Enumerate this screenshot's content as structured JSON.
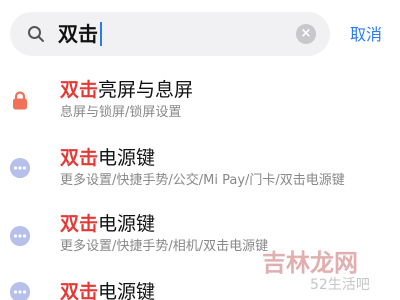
{
  "search": {
    "query": "双击",
    "cancel_label": "取消",
    "clear_glyph": "×"
  },
  "results": [
    {
      "title_highlight": "双击",
      "title_rest": "亮屏与息屏",
      "path": "息屏与锁屏/锁屏设置",
      "icon": "lock-icon"
    },
    {
      "title_highlight": "双击",
      "title_rest": "电源键",
      "path": "更多设置/快捷手势/公交/Mi Pay/门卡/双击电源键",
      "icon": "more-dots-icon"
    },
    {
      "title_highlight": "双击",
      "title_rest": "电源键",
      "path": "更多设置/快捷手势/相机/双击电源键",
      "icon": "more-dots-icon"
    },
    {
      "title_highlight": "双击",
      "title_rest": "电源键",
      "path": "",
      "icon": "more-dots-icon"
    }
  ],
  "watermark": {
    "main": "吉林龙网",
    "sub": "52生活吧"
  },
  "colors": {
    "accent": "#2a7bf6",
    "highlight": "#e53935",
    "lock_icon": "#f0705a",
    "dots_icon": "#b6c0ea"
  }
}
